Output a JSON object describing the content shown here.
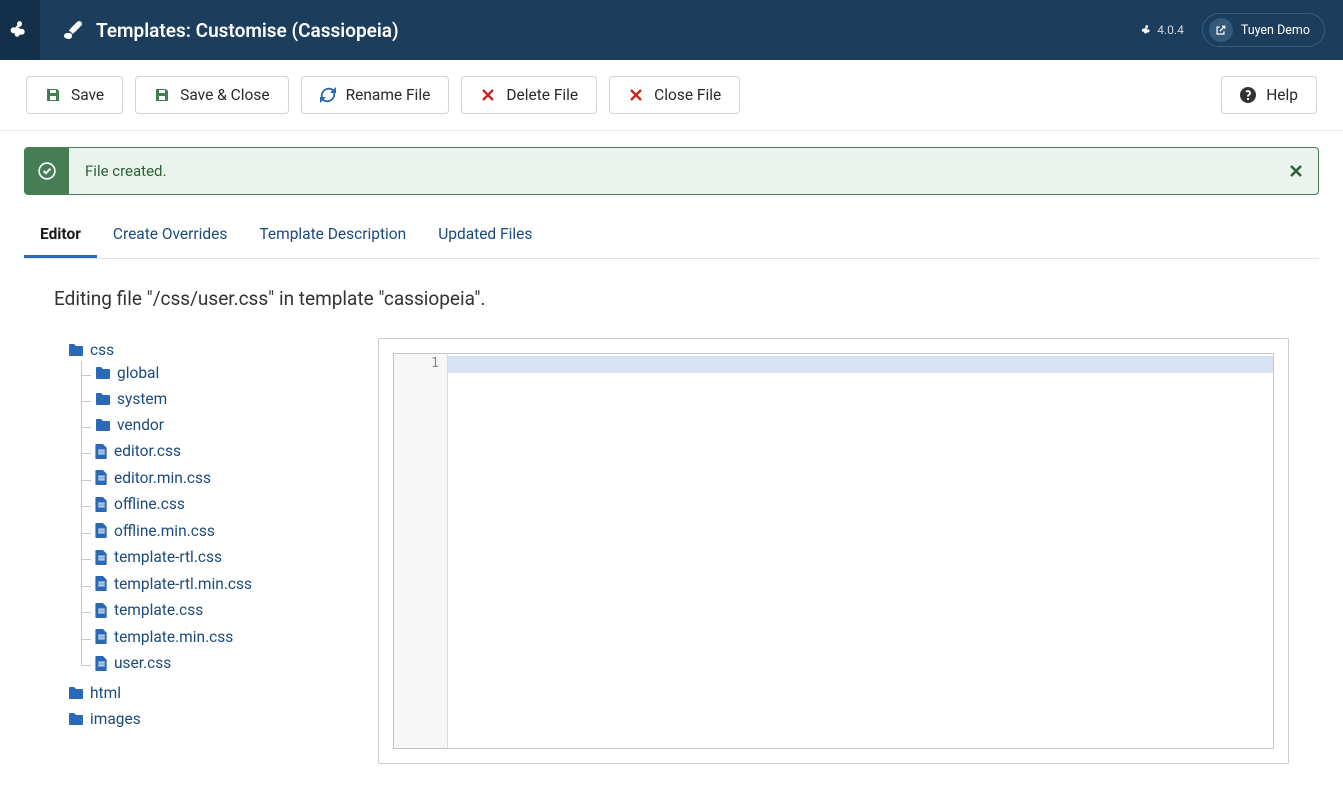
{
  "header": {
    "title": "Templates: Customise (Cassiopeia)",
    "version": "4.0.4",
    "user": "Tuyen Demo"
  },
  "toolbar": {
    "save": "Save",
    "save_close": "Save & Close",
    "rename": "Rename File",
    "delete": "Delete File",
    "close": "Close File",
    "help": "Help"
  },
  "alert": {
    "message": "File created."
  },
  "tabs": {
    "editor": "Editor",
    "overrides": "Create Overrides",
    "description": "Template Description",
    "updated": "Updated Files"
  },
  "main": {
    "heading": "Editing file \"/css/user.css\" in template \"cassiopeia\"."
  },
  "tree": {
    "root": "css",
    "folders": [
      "global",
      "system",
      "vendor"
    ],
    "files": [
      "editor.css",
      "editor.min.css",
      "offline.css",
      "offline.min.css",
      "template-rtl.css",
      "template-rtl.min.css",
      "template.css",
      "template.min.css",
      "user.css"
    ],
    "siblings": [
      "html",
      "images"
    ]
  },
  "editor": {
    "line1": "1",
    "content": ""
  },
  "colors": {
    "save_icon": "#457d54",
    "primary": "#2a69b8",
    "danger": "#c52827"
  }
}
